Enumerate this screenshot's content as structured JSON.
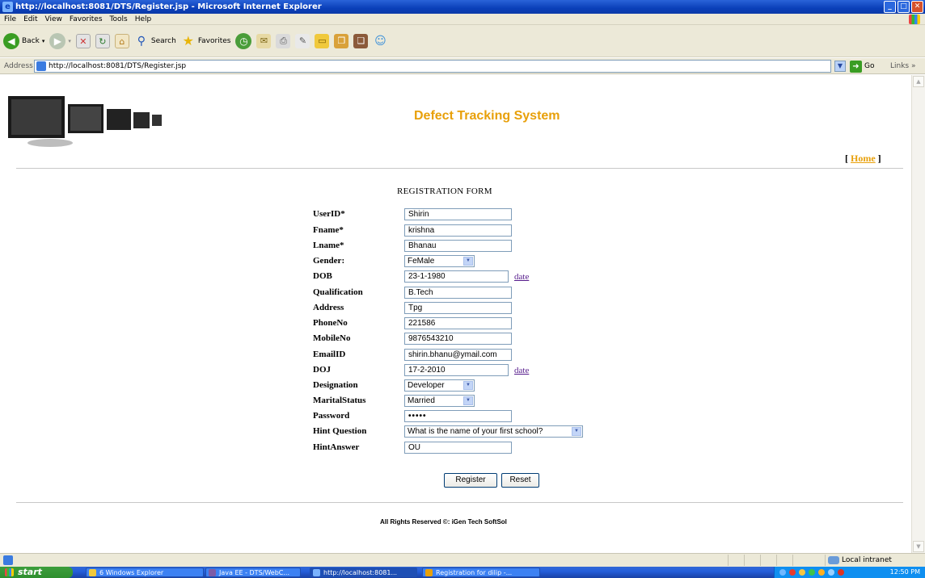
{
  "window": {
    "title": "http://localhost:8081/DTS/Register.jsp - Microsoft Internet Explorer",
    "min": "_",
    "max": "□",
    "close": "✕"
  },
  "menu": [
    "File",
    "Edit",
    "View",
    "Favorites",
    "Tools",
    "Help"
  ],
  "toolbar": {
    "back": "Back",
    "search": "Search",
    "favorites": "Favorites"
  },
  "address": {
    "label": "Address",
    "url": "http://localhost:8081/DTS/Register.jsp",
    "go": "Go",
    "links": "Links"
  },
  "page": {
    "site_title": "Defect Tracking System",
    "home_open": "[",
    "home_link": "Home",
    "home_close": "]",
    "form_title": "REGISTRATION FORM",
    "date_link": "date",
    "register_button": "Register",
    "reset_button": "Reset",
    "footer": "All Rights Reserved ©: iGen Tech SoftSol",
    "fields": {
      "userid": {
        "label": "UserID*",
        "value": "Shirin"
      },
      "fname": {
        "label": "Fname*",
        "value": "krishna"
      },
      "lname": {
        "label": "Lname*",
        "value": "Bhanau"
      },
      "gender": {
        "label": "Gender:",
        "value": "FeMale"
      },
      "dob": {
        "label": "DOB",
        "value": "23-1-1980"
      },
      "qualification": {
        "label": "Qualification",
        "value": "B.Tech"
      },
      "address": {
        "label": "Address",
        "value": "Tpg"
      },
      "phone": {
        "label": "PhoneNo",
        "value": "221586"
      },
      "mobile": {
        "label": "MobileNo",
        "value": "9876543210"
      },
      "email": {
        "label": "EmailID",
        "value": "shirin.bhanu@ymail.com"
      },
      "doj": {
        "label": "DOJ",
        "value": "17-2-2010"
      },
      "designation": {
        "label": "Designation",
        "value": "Developer"
      },
      "marital": {
        "label": "MaritalStatus",
        "value": "Married"
      },
      "password": {
        "label": "Password",
        "value": "•••••"
      },
      "hint_question": {
        "label": "Hint Question",
        "value": "What is the name of your first school?"
      },
      "hint_answer": {
        "label": "HintAnswer",
        "value": "OU"
      }
    }
  },
  "status": {
    "zone": "Local intranet"
  },
  "taskbar": {
    "start": "start",
    "tasks": [
      "6 Windows Explorer",
      "Java EE - DTS/WebC...",
      "http://localhost:8081...",
      "Registration for dilip -..."
    ],
    "clock": "12:50 PM"
  },
  "colors": {
    "accent_title": "#e8a00a",
    "xp_blue": "#245edb",
    "start_green": "#3c9e3c"
  }
}
